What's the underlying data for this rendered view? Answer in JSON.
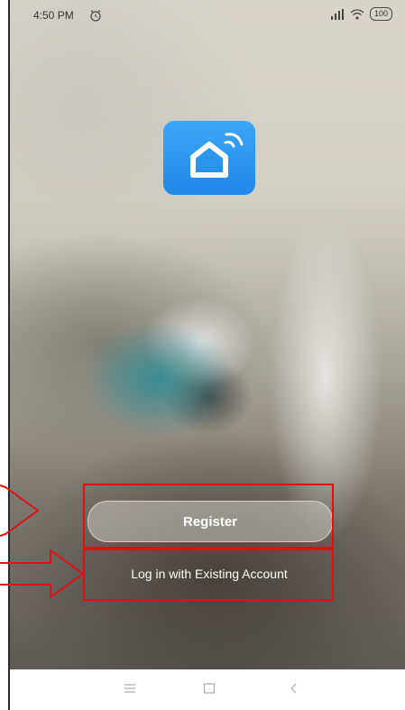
{
  "status_bar": {
    "time": "4:50 PM",
    "battery": "100"
  },
  "actions": {
    "register_label": "Register",
    "login_label": "Log in with Existing Account"
  },
  "colors": {
    "annotation": "#e01010",
    "logo_blue": "#2796ef"
  },
  "icons": [
    "alarm-icon",
    "signal-icon",
    "wifi-icon",
    "battery-icon",
    "smart-home-logo-icon",
    "menu-icon",
    "home-square-icon",
    "back-icon"
  ]
}
